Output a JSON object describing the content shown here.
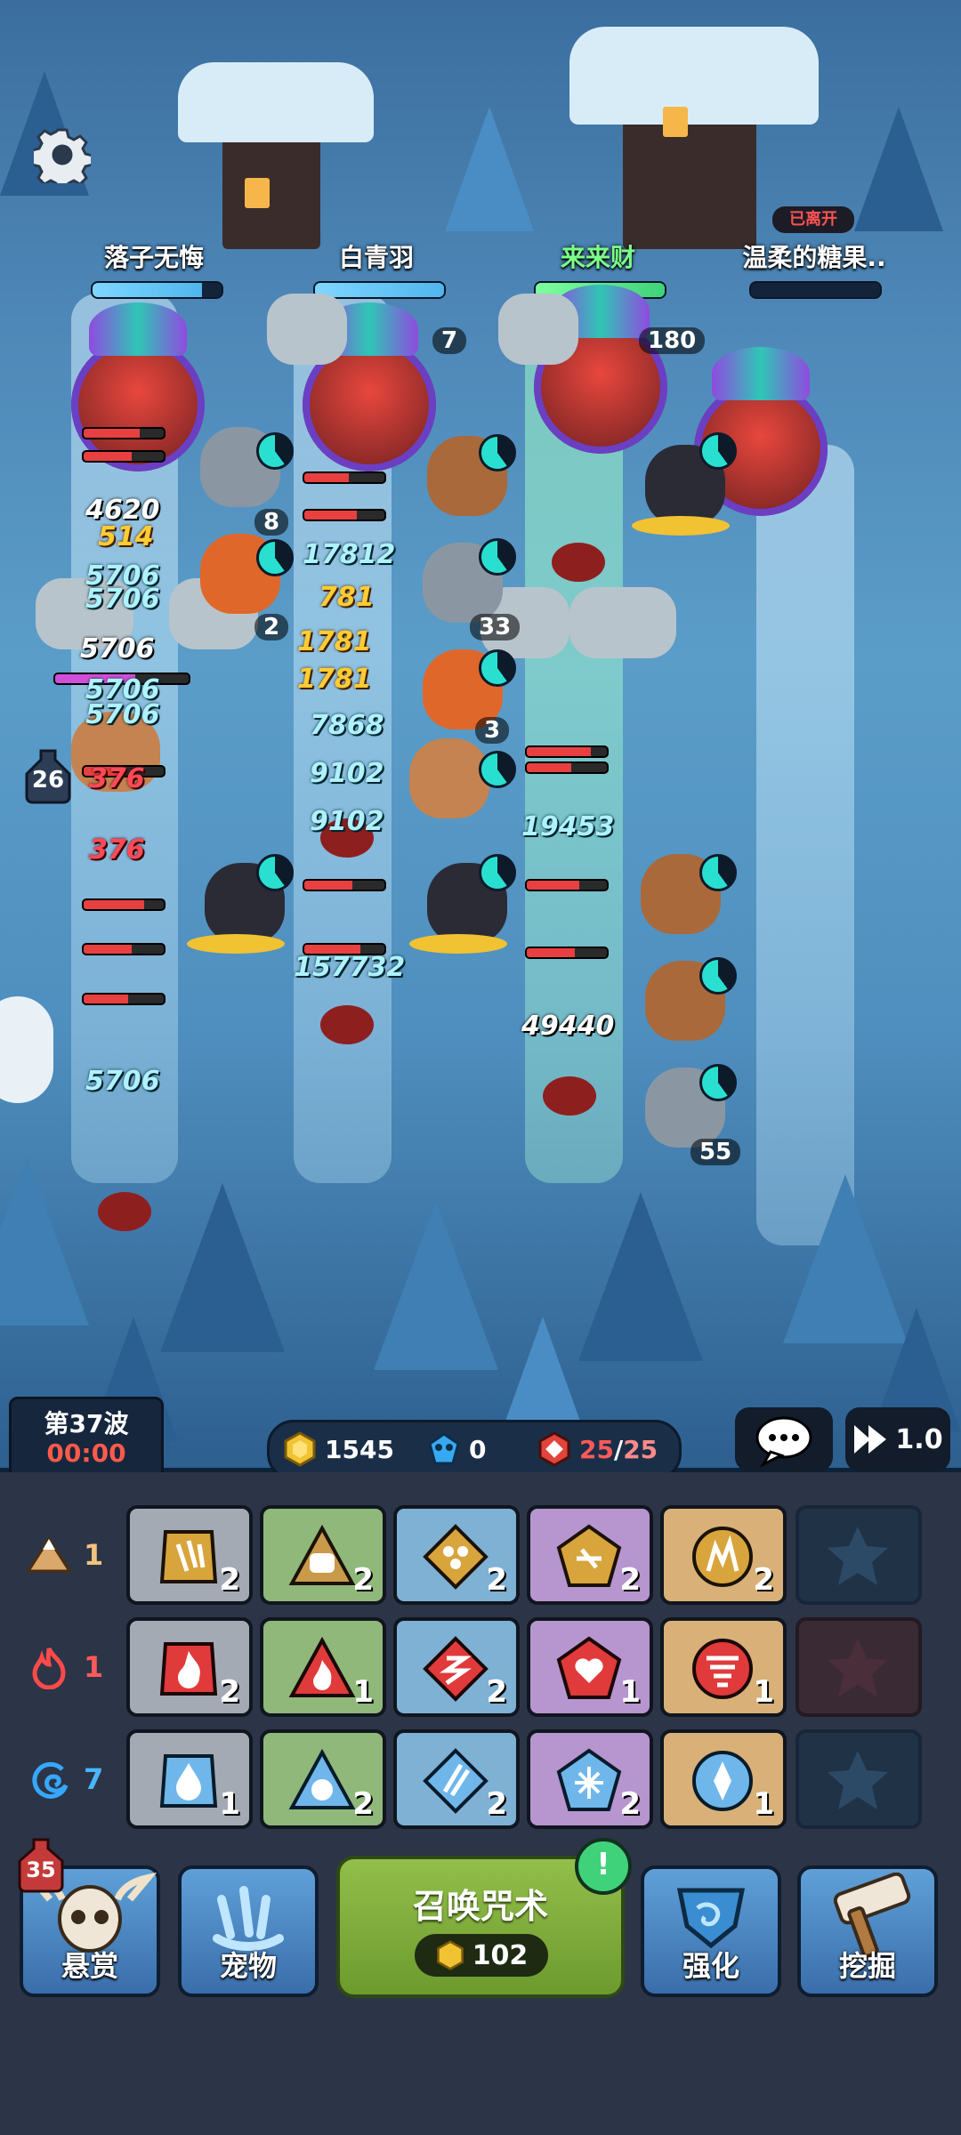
{
  "players": [
    {
      "name": "落子无悔",
      "hp": 0.85,
      "highlight": false
    },
    {
      "name": "白青羽",
      "hp": 1.0,
      "highlight": false
    },
    {
      "name": "来来财",
      "hp": 1.0,
      "highlight": true
    },
    {
      "name": "温柔的糖果..",
      "hp": 0.0,
      "highlight": false,
      "status": "已离开"
    }
  ],
  "unit_levels": [
    "7",
    "180",
    "8",
    "2",
    "33",
    "3",
    "55"
  ],
  "damage_numbers": [
    "4620",
    "514",
    "5706",
    "5706",
    "5706",
    "5706",
    "5706",
    "376",
    "376",
    "5706",
    "17812",
    "781",
    "1781",
    "1781",
    "7868",
    "9102",
    "9102",
    "157732",
    "19453",
    "49440"
  ],
  "wave_indicator": "26",
  "hud": {
    "wave_label": "第37波",
    "timer": "00:00",
    "gold": "1545",
    "gems": "0",
    "unit_count": "25",
    "unit_max": "25",
    "speed": "1.0"
  },
  "element_rows": [
    {
      "element": "earth",
      "count": "1",
      "cards": [
        "2",
        "2",
        "2",
        "2",
        "2"
      ]
    },
    {
      "element": "fire",
      "count": "1",
      "cards": [
        "2",
        "1",
        "2",
        "1",
        "1"
      ]
    },
    {
      "element": "water",
      "count": "7",
      "cards": [
        "1",
        "2",
        "2",
        "2",
        "1"
      ]
    }
  ],
  "actions": {
    "bounty": "悬赏",
    "bounty_badge": "35",
    "pet": "宠物",
    "summon": "召唤咒术",
    "summon_cost": "102",
    "upgrade": "强化",
    "dig": "挖掘"
  },
  "colors": {
    "gold": "#f1c232",
    "timer_red": "#ff5a4a",
    "summon_green": "#7fae3b",
    "ally_hp": "#4fb6ee",
    "highlight_name": "#7cff8a"
  }
}
